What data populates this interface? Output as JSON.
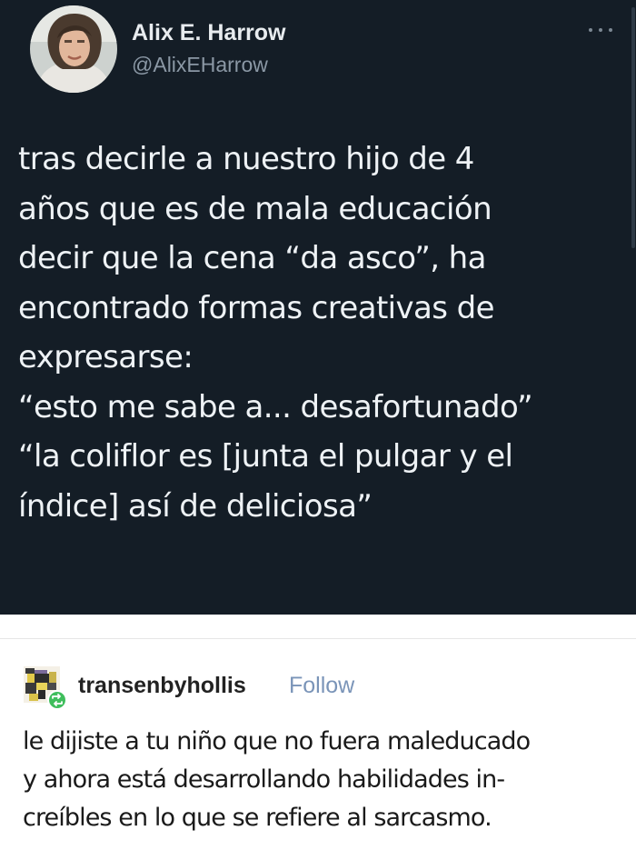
{
  "tweet": {
    "author": {
      "display_name": "Alix E. Harrow",
      "handle": "@AlixEHarrow"
    },
    "more_icon": "ellipsis-icon",
    "text_lines": [
      "tras decirle a nuestro hijo de 4",
      "años que es de mala educación",
      "decir que la cena “da asco”, ha",
      "encontrado formas creativas de",
      "expresarse:",
      "“esto me sabe a... desafortunado”",
      "“la coliflor es [junta el pulgar y el",
      "índice] así de deliciosa”"
    ],
    "colors": {
      "background": "#141d26",
      "text": "#eef2f5",
      "secondary": "#8b98a5"
    }
  },
  "reply": {
    "username": "transenbyhollis",
    "follow_label": "Follow",
    "reblog_badge_icon": "reblog-icon",
    "text_lines": [
      "le dijiste a tu niño que no fuera maleducado",
      "y ahora está desarrollando habilidades in-",
      "creíbles en lo que se refiere al sarcasmo."
    ],
    "colors": {
      "follow": "#7a94b8",
      "reblog_badge": "#3fbe5c"
    }
  }
}
